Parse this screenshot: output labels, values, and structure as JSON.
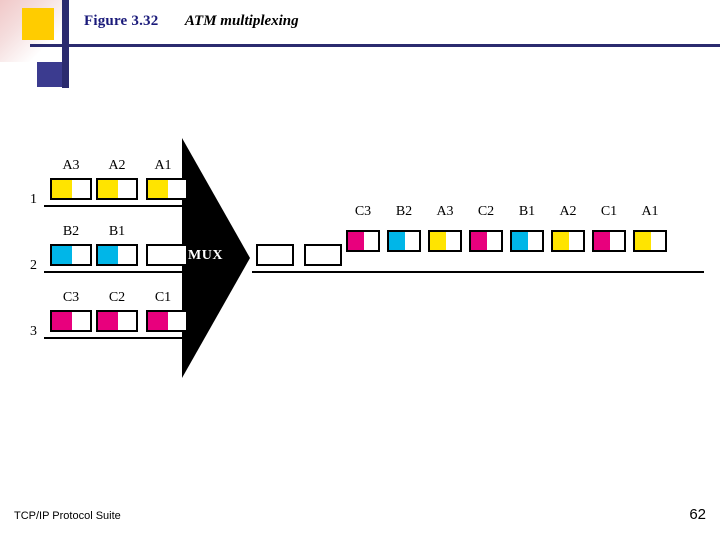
{
  "slide": {
    "figure_label": "Figure 3.32",
    "figure_title": "ATM multiplexing",
    "footer_left": "TCP/IP Protocol Suite",
    "page_number": "62"
  },
  "colors": {
    "magenta": "#e8007d",
    "cyan": "#00b6e8",
    "yellow": "#ffe400",
    "navy": "#2b2b6f",
    "logo_yellow": "#ffcc00",
    "black": "#000000",
    "white": "#ffffff"
  },
  "mux": {
    "label": "MUX"
  },
  "inputs": [
    {
      "lane": "1",
      "cells": [
        {
          "label": "A3",
          "color": "yellow"
        },
        {
          "label": "A2",
          "color": "yellow"
        },
        {
          "label": "A1",
          "color": "yellow"
        }
      ]
    },
    {
      "lane": "2",
      "cells": [
        {
          "label": "B2",
          "color": "cyan"
        },
        {
          "label": "B1",
          "color": "cyan"
        },
        {
          "label": "",
          "color": "empty"
        }
      ]
    },
    {
      "lane": "3",
      "cells": [
        {
          "label": "C3",
          "color": "magenta"
        },
        {
          "label": "C2",
          "color": "magenta"
        },
        {
          "label": "C1",
          "color": "magenta"
        }
      ]
    }
  ],
  "output": {
    "cells": [
      {
        "label": "C3",
        "color": "magenta"
      },
      {
        "label": "B2",
        "color": "cyan"
      },
      {
        "label": "A3",
        "color": "yellow"
      },
      {
        "label": "C2",
        "color": "magenta"
      },
      {
        "label": "B1",
        "color": "cyan"
      },
      {
        "label": "A2",
        "color": "yellow"
      },
      {
        "label": "C1",
        "color": "magenta"
      },
      {
        "label": "A1",
        "color": "yellow"
      }
    ],
    "empty_slots": 2
  }
}
